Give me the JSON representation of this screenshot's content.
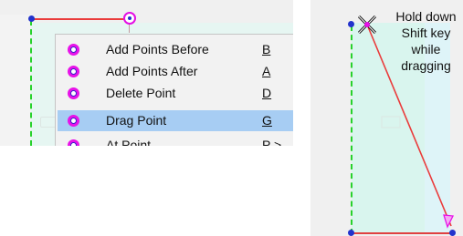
{
  "context_menu": {
    "items": [
      {
        "label": "Add Points Before",
        "shortcut": "B",
        "icon": "point-icon",
        "selected": false
      },
      {
        "label": "Add Points After",
        "shortcut": "A",
        "icon": "point-icon",
        "selected": false
      },
      {
        "label": "Delete Point",
        "shortcut": "D",
        "icon": "point-icon",
        "selected": false
      },
      {
        "label": "Drag Point",
        "shortcut": "G",
        "icon": "point-icon",
        "selected": true
      },
      {
        "label": "At Point",
        "shortcut": "P >",
        "icon": "point-icon",
        "selected": false
      }
    ]
  },
  "tip": {
    "lines": [
      "Hold down",
      "Shift key",
      "while",
      "dragging"
    ]
  },
  "colors": {
    "menu_highlight": "#a7cdf3",
    "point_magenta": "#e812e8",
    "point_blue": "#2233cc",
    "guide_green": "#27d22b",
    "line_red": "#ea3b3b"
  }
}
